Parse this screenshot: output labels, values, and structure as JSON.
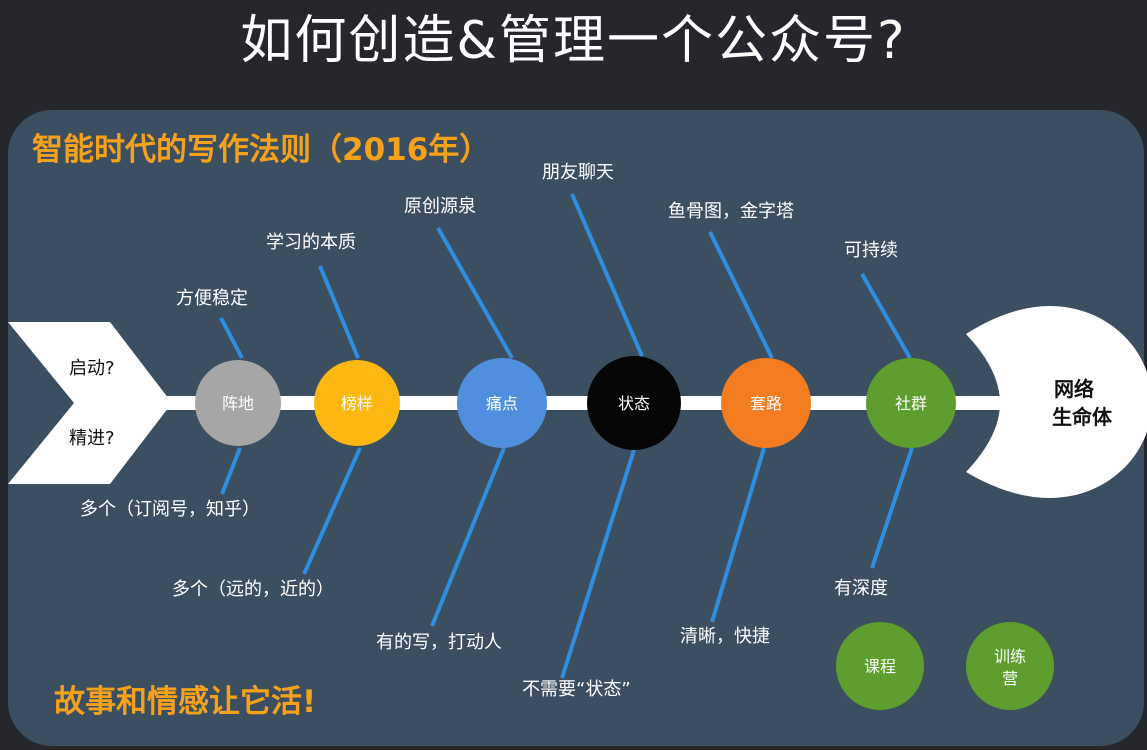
{
  "title": "如何创造&管理一个公众号?",
  "subtitle": "智能时代的写作法则（2016年）",
  "footer": "故事和情感让它活!",
  "tail": {
    "labels": [
      "启动?",
      "精进?"
    ]
  },
  "head": {
    "lines": [
      "网络",
      "生命体"
    ]
  },
  "nodes": [
    {
      "label": "阵地",
      "color": "#a6a6a6",
      "top_label": "方便稳定",
      "bottom_label": "多个（订阅号，知乎）"
    },
    {
      "label": "榜样",
      "color": "#fdb711",
      "top_label": "学习的本质",
      "bottom_label": "多个（远的，近的）"
    },
    {
      "label": "痛点",
      "color": "#4f8fdd",
      "top_label": "原创源泉",
      "bottom_label": "有的写，打动人"
    },
    {
      "label": "状态",
      "color": "#060606",
      "top_label": "朋友聊天",
      "bottom_label": "不需要“状态”"
    },
    {
      "label": "套路",
      "color": "#f27c1f",
      "top_label": "鱼骨图，金字塔",
      "bottom_label": "清晰，快捷"
    },
    {
      "label": "社群",
      "color": "#5d9e2e",
      "top_label": "可持续",
      "bottom_label": "有深度"
    }
  ],
  "extras": [
    {
      "label": "课程",
      "color": "#5d9e2e"
    },
    {
      "label": "训练营",
      "color": "#5d9e2e"
    }
  ],
  "colors": {
    "background": "#24272c",
    "panel": "#3c4f61",
    "accent_text": "#f6a11a",
    "bone_line": "#2f8ee0",
    "spine": "#ffffff"
  }
}
